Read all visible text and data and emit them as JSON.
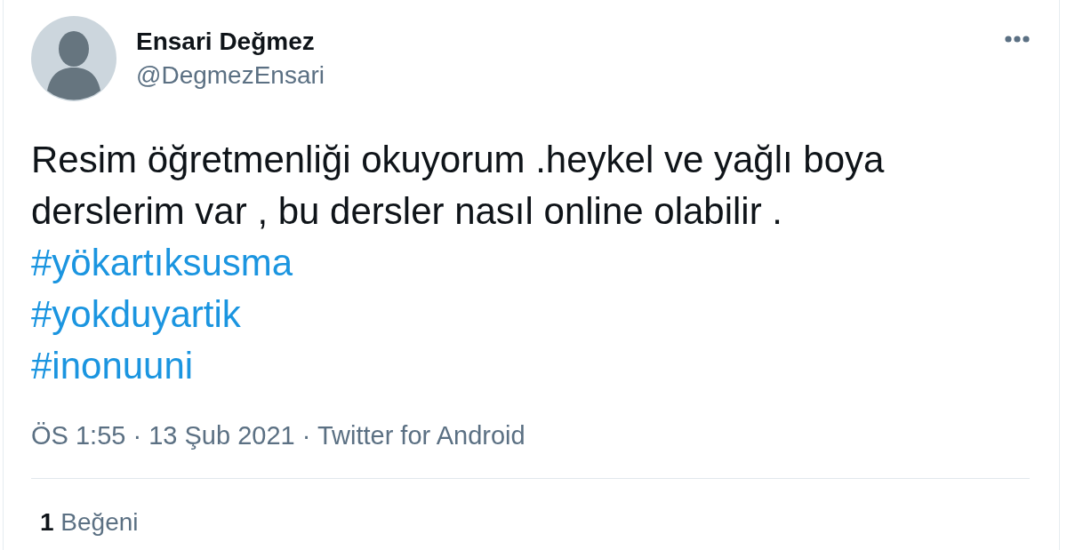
{
  "tweet": {
    "author": {
      "name": "Ensari Değmez",
      "handle": "@DegmezEnsari"
    },
    "text": "Resim öğretmenliği okuyorum .heykel ve yağlı boya derslerim var , bu dersler nasıl online olabilir .",
    "hashtags": [
      "#yökartıksusma",
      "#yokduyartik",
      "#inonuuni"
    ],
    "meta": "ÖS 1:55 · 13 Şub 2021 · Twitter for Android",
    "stats": [
      {
        "count": "1",
        "label": "Beğeni"
      }
    ]
  }
}
